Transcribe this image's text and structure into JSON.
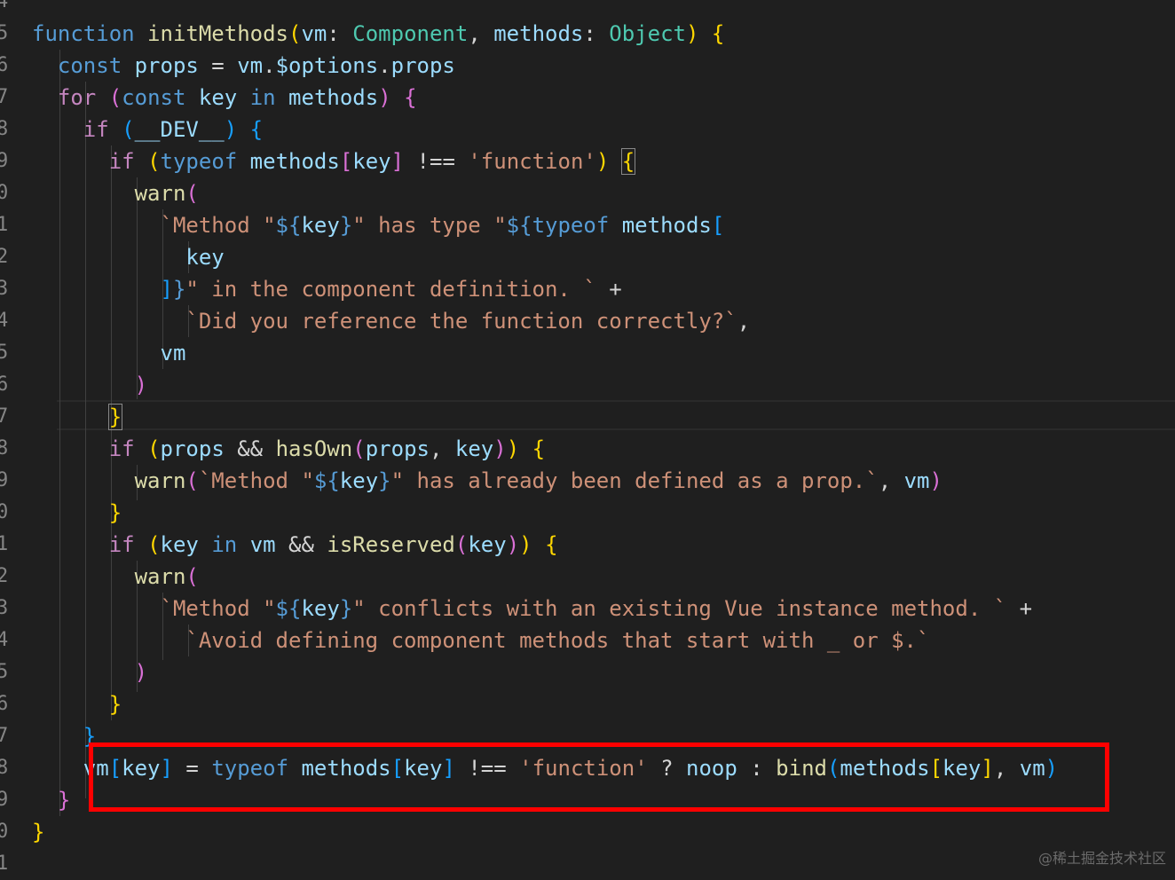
{
  "line_numbers": [
    "4",
    "5",
    "6",
    "7",
    "8",
    "9",
    "0",
    "1",
    "2",
    "3",
    "4",
    "5",
    "6",
    "7",
    "8",
    "9",
    "0",
    "1",
    "2",
    "3",
    "4",
    "5",
    "6",
    "7",
    "8",
    "9",
    "0",
    "1"
  ],
  "lines": [
    [],
    [
      [
        "kw",
        "function"
      ],
      [
        "op",
        " "
      ],
      [
        "fn",
        "initMethods"
      ],
      [
        "b1",
        "("
      ],
      [
        "var",
        "vm"
      ],
      [
        "op",
        ": "
      ],
      [
        "type",
        "Component"
      ],
      [
        "op",
        ", "
      ],
      [
        "var",
        "methods"
      ],
      [
        "op",
        ": "
      ],
      [
        "type",
        "Object"
      ],
      [
        "b1",
        ")"
      ],
      [
        "op",
        " "
      ],
      [
        "b1",
        "{"
      ]
    ],
    [
      [
        "op",
        "  "
      ],
      [
        "kw",
        "const"
      ],
      [
        "op",
        " "
      ],
      [
        "var",
        "props"
      ],
      [
        "op",
        " = "
      ],
      [
        "var",
        "vm"
      ],
      [
        "op",
        "."
      ],
      [
        "var",
        "$options"
      ],
      [
        "op",
        "."
      ],
      [
        "var",
        "props"
      ]
    ],
    [
      [
        "op",
        "  "
      ],
      [
        "ctrl",
        "for"
      ],
      [
        "op",
        " "
      ],
      [
        "b2",
        "("
      ],
      [
        "kw",
        "const"
      ],
      [
        "op",
        " "
      ],
      [
        "var",
        "key"
      ],
      [
        "op",
        " "
      ],
      [
        "kw",
        "in"
      ],
      [
        "op",
        " "
      ],
      [
        "var",
        "methods"
      ],
      [
        "b2",
        ")"
      ],
      [
        "op",
        " "
      ],
      [
        "b2",
        "{"
      ]
    ],
    [
      [
        "op",
        "    "
      ],
      [
        "ctrl",
        "if"
      ],
      [
        "op",
        " "
      ],
      [
        "b3",
        "("
      ],
      [
        "var",
        "__DEV__"
      ],
      [
        "b3",
        ")"
      ],
      [
        "op",
        " "
      ],
      [
        "b3",
        "{"
      ]
    ],
    [
      [
        "op",
        "      "
      ],
      [
        "ctrl",
        "if"
      ],
      [
        "op",
        " "
      ],
      [
        "b1",
        "("
      ],
      [
        "kw",
        "typeof"
      ],
      [
        "op",
        " "
      ],
      [
        "var",
        "methods"
      ],
      [
        "b2",
        "["
      ],
      [
        "var",
        "key"
      ],
      [
        "b2",
        "]"
      ],
      [
        "op",
        " !== "
      ],
      [
        "str",
        "'function'"
      ],
      [
        "b1",
        ")"
      ],
      [
        "op",
        " "
      ],
      [
        "b1",
        "{"
      ]
    ],
    [
      [
        "op",
        "        "
      ],
      [
        "fn",
        "warn"
      ],
      [
        "b2",
        "("
      ]
    ],
    [
      [
        "op",
        "          "
      ],
      [
        "str",
        "`Method \""
      ],
      [
        "tmpl",
        "${"
      ],
      [
        "var",
        "key"
      ],
      [
        "tmpl",
        "}"
      ],
      [
        "str",
        "\" has type \""
      ],
      [
        "tmpl",
        "${"
      ],
      [
        "kw",
        "typeof"
      ],
      [
        "op",
        " "
      ],
      [
        "var",
        "methods"
      ],
      [
        "b3",
        "["
      ]
    ],
    [
      [
        "op",
        "            "
      ],
      [
        "var",
        "key"
      ]
    ],
    [
      [
        "op",
        "          "
      ],
      [
        "b3",
        "]"
      ],
      [
        "tmpl",
        "}"
      ],
      [
        "str",
        "\" in the component definition. `"
      ],
      [
        "op",
        " +"
      ]
    ],
    [
      [
        "op",
        "            "
      ],
      [
        "str",
        "`Did you reference the function correctly?`"
      ],
      [
        "op",
        ","
      ]
    ],
    [
      [
        "op",
        "          "
      ],
      [
        "var",
        "vm"
      ]
    ],
    [
      [
        "op",
        "        "
      ],
      [
        "b2",
        ")"
      ]
    ],
    [
      [
        "op",
        "      "
      ],
      [
        "b1",
        "}"
      ]
    ],
    [
      [
        "op",
        "      "
      ],
      [
        "ctrl",
        "if"
      ],
      [
        "op",
        " "
      ],
      [
        "b1",
        "("
      ],
      [
        "var",
        "props"
      ],
      [
        "op",
        " && "
      ],
      [
        "fn",
        "hasOwn"
      ],
      [
        "b2",
        "("
      ],
      [
        "var",
        "props"
      ],
      [
        "op",
        ", "
      ],
      [
        "var",
        "key"
      ],
      [
        "b2",
        ")"
      ],
      [
        "b1",
        ")"
      ],
      [
        "op",
        " "
      ],
      [
        "b1",
        "{"
      ]
    ],
    [
      [
        "op",
        "        "
      ],
      [
        "fn",
        "warn"
      ],
      [
        "b2",
        "("
      ],
      [
        "str",
        "`Method \""
      ],
      [
        "tmpl",
        "${"
      ],
      [
        "var",
        "key"
      ],
      [
        "tmpl",
        "}"
      ],
      [
        "str",
        "\" has already been defined as a prop.`"
      ],
      [
        "op",
        ", "
      ],
      [
        "var",
        "vm"
      ],
      [
        "b2",
        ")"
      ]
    ],
    [
      [
        "op",
        "      "
      ],
      [
        "b1",
        "}"
      ]
    ],
    [
      [
        "op",
        "      "
      ],
      [
        "ctrl",
        "if"
      ],
      [
        "op",
        " "
      ],
      [
        "b1",
        "("
      ],
      [
        "var",
        "key"
      ],
      [
        "op",
        " "
      ],
      [
        "kw",
        "in"
      ],
      [
        "op",
        " "
      ],
      [
        "var",
        "vm"
      ],
      [
        "op",
        " && "
      ],
      [
        "fn",
        "isReserved"
      ],
      [
        "b2",
        "("
      ],
      [
        "var",
        "key"
      ],
      [
        "b2",
        ")"
      ],
      [
        "b1",
        ")"
      ],
      [
        "op",
        " "
      ],
      [
        "b1",
        "{"
      ]
    ],
    [
      [
        "op",
        "        "
      ],
      [
        "fn",
        "warn"
      ],
      [
        "b2",
        "("
      ]
    ],
    [
      [
        "op",
        "          "
      ],
      [
        "str",
        "`Method \""
      ],
      [
        "tmpl",
        "${"
      ],
      [
        "var",
        "key"
      ],
      [
        "tmpl",
        "}"
      ],
      [
        "str",
        "\" conflicts with an existing Vue instance method. `"
      ],
      [
        "op",
        " +"
      ]
    ],
    [
      [
        "op",
        "            "
      ],
      [
        "str",
        "`Avoid defining component methods that start with _ or $.`"
      ]
    ],
    [
      [
        "op",
        "        "
      ],
      [
        "b2",
        ")"
      ]
    ],
    [
      [
        "op",
        "      "
      ],
      [
        "b1",
        "}"
      ]
    ],
    [
      [
        "op",
        "    "
      ],
      [
        "b3",
        "}"
      ]
    ],
    [
      [
        "op",
        "    "
      ],
      [
        "var",
        "vm"
      ],
      [
        "b3",
        "["
      ],
      [
        "var",
        "key"
      ],
      [
        "b3",
        "]"
      ],
      [
        "op",
        " = "
      ],
      [
        "kw",
        "typeof"
      ],
      [
        "op",
        " "
      ],
      [
        "var",
        "methods"
      ],
      [
        "b3",
        "["
      ],
      [
        "var",
        "key"
      ],
      [
        "b3",
        "]"
      ],
      [
        "op",
        " !== "
      ],
      [
        "str",
        "'function'"
      ],
      [
        "op",
        " ? "
      ],
      [
        "var",
        "noop"
      ],
      [
        "op",
        " : "
      ],
      [
        "fn",
        "bind"
      ],
      [
        "b3",
        "("
      ],
      [
        "var",
        "methods"
      ],
      [
        "b1",
        "["
      ],
      [
        "var",
        "key"
      ],
      [
        "b1",
        "]"
      ],
      [
        "op",
        ", "
      ],
      [
        "var",
        "vm"
      ],
      [
        "b3",
        ")"
      ]
    ],
    [
      [
        "op",
        "  "
      ],
      [
        "b2",
        "}"
      ]
    ],
    [
      [
        "b1",
        "}"
      ]
    ],
    []
  ],
  "watermark": "@稀土掘金技术社区"
}
